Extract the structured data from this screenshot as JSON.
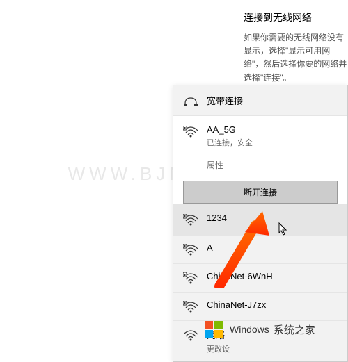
{
  "watermark": "WWW.BJMLV.COM",
  "header": {
    "title": "连接到无线网络",
    "description": "如果你需要的无线网络没有显示，选择\"显示可用网络\"，然后选择你要的网络并选择\"连接\"。"
  },
  "broadband": {
    "label": "宽带连接"
  },
  "connected_network": {
    "name": "AA_5G",
    "status": "已连接，安全",
    "properties_label": "属性",
    "disconnect_label": "断开连接"
  },
  "networks": [
    {
      "name": "1234"
    },
    {
      "name": "A"
    },
    {
      "name": "ChinaNet-6WnH"
    },
    {
      "name": "ChinaNet-J7zx"
    }
  ],
  "bottom_item": {
    "label": "网络",
    "sub": "更改设"
  },
  "branding": {
    "text1": "Windows",
    "text2": "系统之家"
  }
}
